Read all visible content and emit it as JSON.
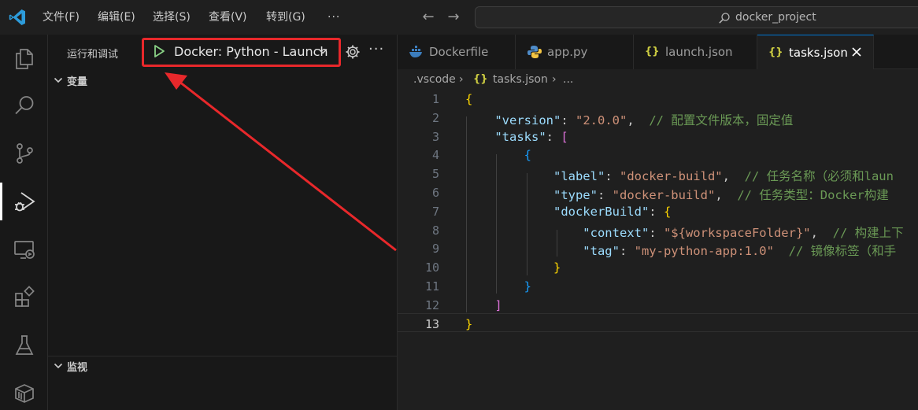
{
  "menu": [
    "文件(F)",
    "编辑(E)",
    "选择(S)",
    "查看(V)",
    "转到(G)",
    "···"
  ],
  "command_center": {
    "text": "docker_project"
  },
  "activity_bar": [
    "explorer-icon",
    "search-icon",
    "source-control-icon",
    "run-debug-icon",
    "remote-explorer-icon",
    "extensions-icon",
    "testing-icon",
    "docker-icon"
  ],
  "sidebar": {
    "title": "运行和调试",
    "launch_config": "Docker: Python - Launch",
    "sections": {
      "variables": "变量",
      "watch": "监视"
    }
  },
  "tabs": [
    {
      "label": "Dockerfile",
      "icon": "docker-file-icon"
    },
    {
      "label": "app.py",
      "icon": "python-file-icon"
    },
    {
      "label": "launch.json",
      "icon": "json-file-icon"
    },
    {
      "label": "tasks.json",
      "icon": "json-file-icon",
      "active": true
    }
  ],
  "breadcrumb": {
    "folder": ".vscode",
    "file": "tasks.json",
    "more": "..."
  },
  "editor": {
    "line_numbers": [
      "1",
      "2",
      "3",
      "4",
      "5",
      "6",
      "7",
      "8",
      "9",
      "10",
      "11",
      "12",
      "13"
    ],
    "lines": [
      [
        [
          "b1",
          "{"
        ]
      ],
      [
        [
          "k",
          "    \"version\""
        ],
        [
          "p",
          ": "
        ],
        [
          "s",
          "\"2.0.0\""
        ],
        [
          "p",
          ",  "
        ],
        [
          "c",
          "// 配置文件版本，固定值"
        ]
      ],
      [
        [
          "k",
          "    \"tasks\""
        ],
        [
          "p",
          ": "
        ],
        [
          "b2",
          "["
        ]
      ],
      [
        [
          "b3",
          "        {"
        ]
      ],
      [
        [
          "k",
          "            \"label\""
        ],
        [
          "p",
          ": "
        ],
        [
          "s",
          "\"docker-build\""
        ],
        [
          "p",
          ",  "
        ],
        [
          "c",
          "// 任务名称（必须和laun"
        ]
      ],
      [
        [
          "k",
          "            \"type\""
        ],
        [
          "p",
          ": "
        ],
        [
          "s",
          "\"docker-build\""
        ],
        [
          "p",
          ",  "
        ],
        [
          "c",
          "// 任务类型：Docker构建"
        ]
      ],
      [
        [
          "k",
          "            \"dockerBuild\""
        ],
        [
          "p",
          ": "
        ],
        [
          "b1",
          "{"
        ]
      ],
      [
        [
          "k",
          "                \"context\""
        ],
        [
          "p",
          ": "
        ],
        [
          "s",
          "\"${workspaceFolder}\""
        ],
        [
          "p",
          ",  "
        ],
        [
          "c",
          "// 构建上下"
        ]
      ],
      [
        [
          "k",
          "                \"tag\""
        ],
        [
          "p",
          ": "
        ],
        [
          "s",
          "\"my-python-app:1.0\""
        ],
        [
          "p",
          "  "
        ],
        [
          "c",
          "// 镜像标签（和手"
        ]
      ],
      [
        [
          "b1",
          "            }"
        ]
      ],
      [
        [
          "b3",
          "        }"
        ]
      ],
      [
        [
          "b2",
          "    ]"
        ]
      ],
      [
        [
          "b1",
          "}"
        ]
      ]
    ]
  },
  "colors": {
    "highlight_box": "#e8282b",
    "active_tab_border": "#0078d4"
  }
}
